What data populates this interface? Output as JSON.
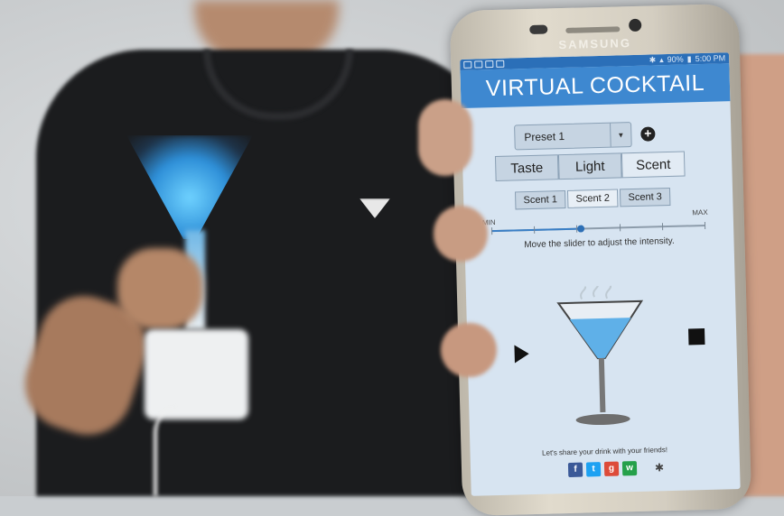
{
  "phone": {
    "brand": "SAMSUNG",
    "status": {
      "left_icons": [
        "notification-icon",
        "mail-icon",
        "wifi-icon",
        "image-icon"
      ],
      "battery": "90%",
      "time": "5:00 PM"
    }
  },
  "app": {
    "title": "VIRTUAL COCKTAIL",
    "preset": {
      "selected": "Preset 1"
    },
    "main_tabs": [
      {
        "label": "Taste",
        "active": false
      },
      {
        "label": "Light",
        "active": false
      },
      {
        "label": "Scent",
        "active": true
      }
    ],
    "sub_tabs": [
      {
        "label": "Scent 1",
        "active": false
      },
      {
        "label": "Scent 2",
        "active": true
      },
      {
        "label": "Scent 3",
        "active": false
      }
    ],
    "slider": {
      "min_label": "MIN",
      "max_label": "MAX",
      "value_fraction": 0.42,
      "ticks": 6
    },
    "slider_hint": "Move the slider to adjust the intensity.",
    "share_text": "Let's share your drink with your friends!",
    "share_icons": [
      "facebook-icon",
      "twitter-icon",
      "google-plus-icon",
      "whatsapp-icon",
      "bluetooth-icon"
    ],
    "colors": {
      "appbar": "#3e88d0",
      "screen_bg": "#d7e4f1",
      "liquid": "#5fb0e8"
    }
  }
}
